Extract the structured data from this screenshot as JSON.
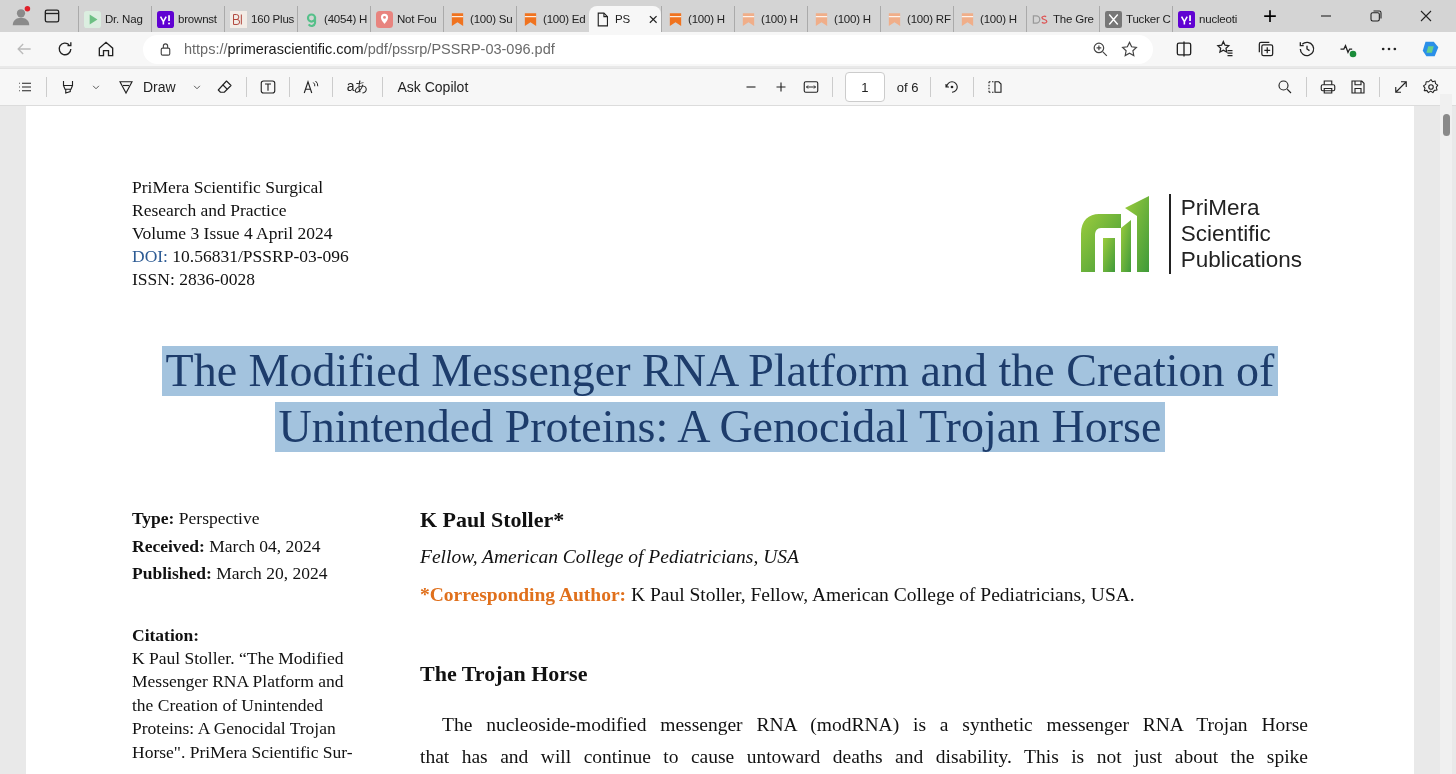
{
  "browser": {
    "tabs": [
      {
        "title": "Dr. Nag",
        "kind": "play",
        "selected": false
      },
      {
        "title": "brownst",
        "kind": "yahoo",
        "selected": false
      },
      {
        "title": "160 Plus",
        "kind": "bi",
        "selected": false
      },
      {
        "title": "(4054) H",
        "kind": "g",
        "selected": false
      },
      {
        "title": "Not Fou",
        "kind": "pin",
        "selected": false
      },
      {
        "title": "(100) Su",
        "kind": "bookmark",
        "selected": false
      },
      {
        "title": "(100) Ed",
        "kind": "bookmark",
        "selected": false
      },
      {
        "title": "PS",
        "kind": "doc",
        "selected": true,
        "close": "×"
      },
      {
        "title": "(100) H",
        "kind": "bookmark",
        "selected": false
      },
      {
        "title": "(100) H",
        "kind": "bookmark-light",
        "selected": false
      },
      {
        "title": "(100) H",
        "kind": "bookmark-light",
        "selected": false
      },
      {
        "title": "(100) RF",
        "kind": "bookmark-light",
        "selected": false
      },
      {
        "title": "(100) H",
        "kind": "bookmark-light",
        "selected": false
      },
      {
        "title": "The Gre",
        "kind": "ds",
        "selected": false
      },
      {
        "title": "Tucker C",
        "kind": "x",
        "selected": false
      },
      {
        "title": "nucleoti",
        "kind": "yahoo",
        "selected": false
      }
    ],
    "new_tab": "+",
    "url": {
      "scheme": "https://",
      "host": "primerascientific.com",
      "path": "/pdf/pssrp/PSSRP-03-096.pdf"
    }
  },
  "pdf_toolbar": {
    "draw": "Draw",
    "translate": "aあ",
    "copilot": "Ask Copilot",
    "page": "1",
    "page_count": "of 6"
  },
  "document": {
    "journal_lines": [
      "PriMera Scientific Surgical",
      "Research and Practice",
      "Volume 3 Issue 4 April 2024"
    ],
    "doi": {
      "label": "DOI:",
      "value": "10.56831/PSSRP-03-096"
    },
    "issn": "ISSN: 2836-0028",
    "logo_text": "PriMera\nScientific\nPublications",
    "title_lines": [
      {
        "text": "The Modified Messenger RNA Platform and the Creation of",
        "highlighted": true
      },
      {
        "text": "Unintended Proteins: A Genocidal Trojan Horse",
        "highlighted": true
      }
    ],
    "meta": [
      {
        "label": "Type:",
        "value": "Perspective"
      },
      {
        "label": "Received:",
        "value": "March 04, 2024"
      },
      {
        "label": "Published:",
        "value": "March 20, 2024"
      }
    ],
    "citation": {
      "label": "Citation:",
      "text": "K Paul Stoller. “The Modified\nMessenger RNA Platform and\nthe Creation of Unintended\nProteins: A Genocidal Trojan\nHorse\". PriMera Scientific Sur-"
    },
    "author": "K Paul Stoller*",
    "affiliation": "Fellow, American College of Pediatricians, USA",
    "corresponding": {
      "label": "*Corresponding Author:",
      "text": "K Paul Stoller, Fellow, American College of Pediatricians, USA."
    },
    "section_heading": "The Trojan Horse",
    "paragraph": "The nucleoside-modified messenger RNA (modRNA) is a synthetic messenger RNA Trojan Horse\nthat has and will continue to cause untoward deaths and disability. This is not just about the spike"
  }
}
